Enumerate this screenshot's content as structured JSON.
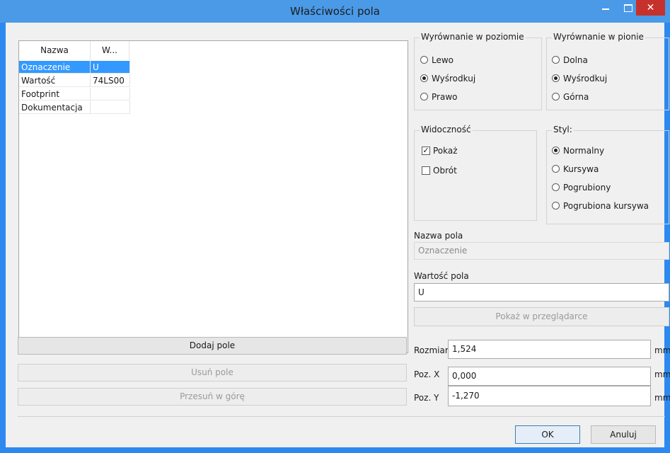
{
  "window": {
    "title": "Właściwości pola",
    "close_glyph": "✕"
  },
  "table": {
    "headers": [
      "Nazwa",
      "W..."
    ],
    "rows": [
      {
        "name": "Oznaczenie",
        "value": "U"
      },
      {
        "name": "Wartość",
        "value": "74LS00"
      },
      {
        "name": "Footprint",
        "value": ""
      },
      {
        "name": "Dokumentacja",
        "value": ""
      }
    ]
  },
  "buttons": {
    "add": "Dodaj pole",
    "remove": "Usuń pole",
    "move_up": "Przesuń w górę",
    "show_browser": "Pokaż w przeglądarce",
    "ok": "OK",
    "cancel": "Anuluj"
  },
  "horizontal": {
    "label": "Wyrównanie w poziomie",
    "options": [
      "Lewo",
      "Wyśrodkuj",
      "Prawo"
    ],
    "selected": "Wyśrodkuj"
  },
  "vertical": {
    "label": "Wyrównanie w pionie",
    "options": [
      "Dolna",
      "Wyśrodkuj",
      "Górna"
    ],
    "selected": "Wyśrodkuj"
  },
  "visibility": {
    "label": "Widoczność",
    "show": "Pokaż",
    "show_checked": true,
    "rotate": "Obrót",
    "rotate_checked": false,
    "check_glyph": "✓"
  },
  "style": {
    "label": "Styl:",
    "options": [
      "Normalny",
      "Kursywa",
      "Pogrubiony",
      "Pogrubiona kursywa"
    ],
    "selected": "Normalny"
  },
  "field_name": {
    "label": "Nazwa pola",
    "value": "Oznaczenie"
  },
  "field_value": {
    "label": "Wartość pola",
    "value": "U"
  },
  "size": {
    "label": "Rozmiar",
    "value": "1,524",
    "unit": "mm"
  },
  "pos_x": {
    "label": "Poz. X",
    "value": "0,000",
    "unit": "mm"
  },
  "pos_y": {
    "label": "Poz. Y",
    "value": "-1,270",
    "unit": "mm"
  }
}
